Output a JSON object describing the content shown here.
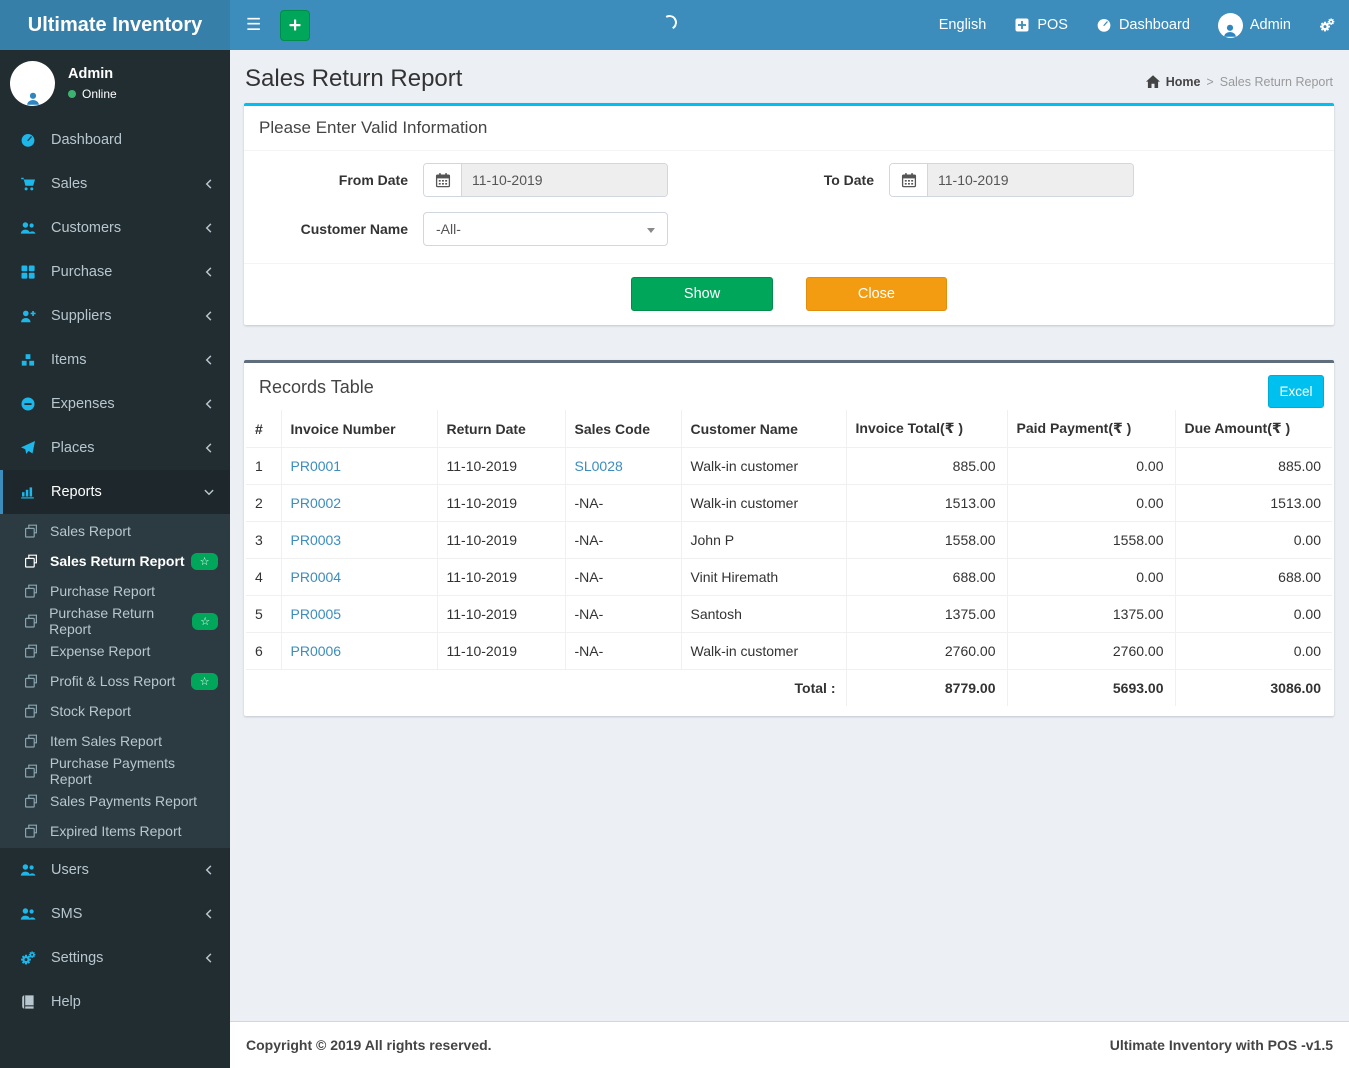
{
  "navbar": {
    "brand": "Ultimate Inventory",
    "language": "English",
    "pos_label": "POS",
    "dashboard_label": "Dashboard",
    "user_label": "Admin"
  },
  "sidebar": {
    "user": {
      "name": "Admin",
      "status": "Online"
    },
    "items": [
      {
        "label": "Dashboard",
        "icon": "tachometer-icon"
      },
      {
        "label": "Sales",
        "icon": "cart-icon",
        "chevron": true
      },
      {
        "label": "Customers",
        "icon": "users-icon",
        "chevron": true
      },
      {
        "label": "Purchase",
        "icon": "grid-icon",
        "chevron": true
      },
      {
        "label": "Suppliers",
        "icon": "user-plus-icon",
        "chevron": true
      },
      {
        "label": "Items",
        "icon": "cubes-icon",
        "chevron": true
      },
      {
        "label": "Expenses",
        "icon": "minus-circle-icon",
        "chevron": true
      },
      {
        "label": "Places",
        "icon": "paper-plane-icon",
        "chevron": true
      },
      {
        "label": "Reports",
        "icon": "bar-chart-icon",
        "active": true,
        "expanded": true,
        "children": [
          {
            "label": "Sales Report"
          },
          {
            "label": "Sales Return Report",
            "active": true,
            "badge": "star"
          },
          {
            "label": "Purchase Report"
          },
          {
            "label": "Purchase Return Report",
            "badge": "star"
          },
          {
            "label": "Expense Report"
          },
          {
            "label": "Profit & Loss Report",
            "badge": "star"
          },
          {
            "label": "Stock Report"
          },
          {
            "label": "Item Sales Report"
          },
          {
            "label": "Purchase Payments Report"
          },
          {
            "label": "Sales Payments Report"
          },
          {
            "label": "Expired Items Report"
          }
        ]
      },
      {
        "label": "Users",
        "icon": "users-icon",
        "chevron": true
      },
      {
        "label": "SMS",
        "icon": "users-icon",
        "chevron": true
      },
      {
        "label": "Settings",
        "icon": "gears-icon",
        "chevron": true
      },
      {
        "label": "Help",
        "icon": "book-icon",
        "muted": true
      }
    ]
  },
  "content": {
    "page_title": "Sales Return Report",
    "breadcrumb": {
      "home": "Home",
      "separator": ">",
      "current": "Sales Return Report"
    }
  },
  "filter": {
    "title": "Please Enter Valid Information",
    "from_date": {
      "label": "From Date",
      "value": "11-10-2019"
    },
    "to_date": {
      "label": "To Date",
      "value": "11-10-2019"
    },
    "customer": {
      "label": "Customer Name",
      "value": "-All-"
    },
    "show_label": "Show",
    "close_label": "Close"
  },
  "records": {
    "title": "Records Table",
    "excel_label": "Excel",
    "headers": [
      "#",
      "Invoice Number",
      "Return Date",
      "Sales Code",
      "Customer Name",
      "Invoice Total(₹ )",
      "Paid Payment(₹ )",
      "Due Amount(₹ )"
    ],
    "rows": [
      {
        "num": "1",
        "invoice": "PR0001",
        "date": "11-10-2019",
        "code": "SL0028",
        "code_link": true,
        "customer": "Walk-in customer",
        "total": "885.00",
        "paid": "0.00",
        "due": "885.00"
      },
      {
        "num": "2",
        "invoice": "PR0002",
        "date": "11-10-2019",
        "code": "-NA-",
        "code_link": false,
        "customer": "Walk-in customer",
        "total": "1513.00",
        "paid": "0.00",
        "due": "1513.00"
      },
      {
        "num": "3",
        "invoice": "PR0003",
        "date": "11-10-2019",
        "code": "-NA-",
        "code_link": false,
        "customer": "John P",
        "total": "1558.00",
        "paid": "1558.00",
        "due": "0.00"
      },
      {
        "num": "4",
        "invoice": "PR0004",
        "date": "11-10-2019",
        "code": "-NA-",
        "code_link": false,
        "customer": "Vinit Hiremath",
        "total": "688.00",
        "paid": "0.00",
        "due": "688.00"
      },
      {
        "num": "5",
        "invoice": "PR0005",
        "date": "11-10-2019",
        "code": "-NA-",
        "code_link": false,
        "customer": "Santosh",
        "total": "1375.00",
        "paid": "1375.00",
        "due": "0.00"
      },
      {
        "num": "6",
        "invoice": "PR0006",
        "date": "11-10-2019",
        "code": "-NA-",
        "code_link": false,
        "customer": "Walk-in customer",
        "total": "2760.00",
        "paid": "2760.00",
        "due": "0.00"
      }
    ],
    "total": {
      "label": "Total :",
      "invoice_total": "8779.00",
      "paid_total": "5693.00",
      "due_total": "3086.00"
    }
  },
  "footer": {
    "left": "Copyright © 2019 All rights reserved.",
    "right": "Ultimate Inventory with POS -v1.5"
  },
  "colors": {
    "navbar_blue": "#3c8dbc",
    "brand_blue": "#367fa9",
    "sidebar_dark": "#222d32",
    "submenu_dark": "#2c3b41",
    "accent_cyan": "#00c0ef",
    "icon_cyan": "#1eb7ea",
    "success_green": "#00a65a",
    "warning_orange": "#f39c12",
    "link_blue": "#3c8dbc"
  }
}
